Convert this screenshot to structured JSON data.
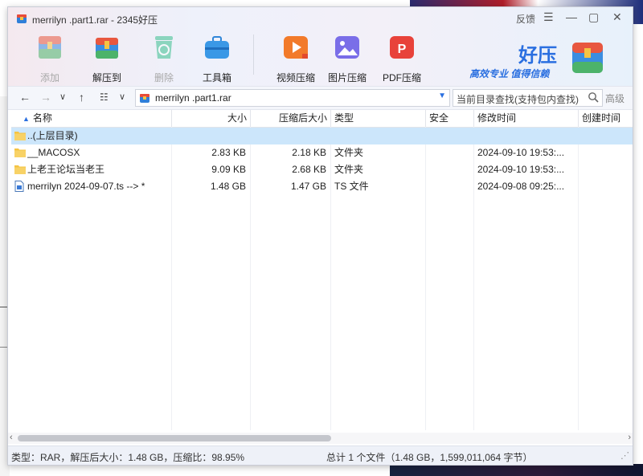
{
  "window": {
    "title": "merrilyn .part1.rar - 2345好压",
    "feedback": "反馈",
    "menu_icon": "menu-icon",
    "min_icon": "minimize-icon",
    "max_icon": "maximize-icon",
    "close_icon": "close-icon"
  },
  "toolbar": {
    "items": [
      {
        "label": "添加",
        "icon": "add-archive-icon",
        "disabled": true
      },
      {
        "label": "解压到",
        "icon": "extract-to-icon",
        "disabled": false
      },
      {
        "label": "删除",
        "icon": "delete-icon",
        "disabled": true
      },
      {
        "label": "工具箱",
        "icon": "toolbox-icon",
        "disabled": false
      },
      {
        "label": "视频压缩",
        "icon": "video-compress-icon",
        "disabled": false
      },
      {
        "label": "图片压缩",
        "icon": "image-compress-icon",
        "disabled": false
      },
      {
        "label": "PDF压缩",
        "icon": "pdf-compress-icon",
        "disabled": false
      }
    ]
  },
  "brand": {
    "name": "好压",
    "slogan": "高效专业  值得信赖"
  },
  "navbar": {
    "path": "merrilyn .part1.rar",
    "search_placeholder": "当前目录查找(支持包内查找)",
    "advanced": "高级"
  },
  "table": {
    "columns": [
      "名称",
      "大小",
      "压缩后大小",
      "类型",
      "安全",
      "修改时间",
      "创建时间"
    ],
    "rows": [
      {
        "name": "..(上层目录)",
        "size": "",
        "packed": "",
        "type": "",
        "secure": "",
        "modified": "",
        "created": "",
        "icon": "folder-icon",
        "selected": true
      },
      {
        "name": "__MACOSX",
        "size": "2.83 KB",
        "packed": "2.18 KB",
        "type": "文件夹",
        "secure": "",
        "modified": "2024-09-10 19:53:...",
        "created": "",
        "icon": "folder-icon",
        "selected": false
      },
      {
        "name": "上老王论坛当老王",
        "size": "9.09 KB",
        "packed": "2.68 KB",
        "type": "文件夹",
        "secure": "",
        "modified": "2024-09-10 19:53:...",
        "created": "",
        "icon": "folder-icon",
        "selected": false
      },
      {
        "name": "merrilyn 2024-09-07.ts --> *",
        "size": "1.48 GB",
        "packed": "1.47 GB",
        "type": "TS 文件",
        "secure": "",
        "modified": "2024-09-08 09:25:...",
        "created": "",
        "icon": "ts-file-icon",
        "selected": false
      }
    ]
  },
  "status": {
    "left": "类型：RAR，解压后大小：1.48 GB，压缩比：98.95%",
    "right": "总计 1 个文件（1.48 GB，1,599,011,064 字节）"
  },
  "colors": {
    "accent": "#2a6fe0",
    "selected_row": "#cce6fb"
  }
}
